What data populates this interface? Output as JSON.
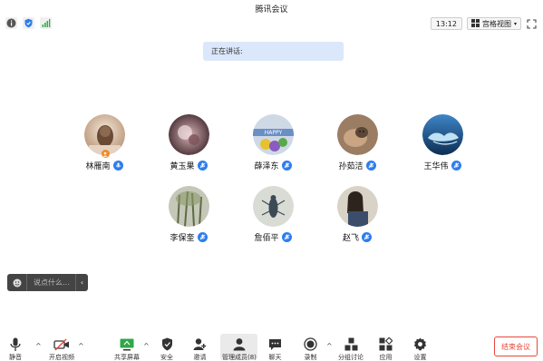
{
  "window": {
    "title": "腾讯会议"
  },
  "top_toolbar": {
    "info_icon": "info-icon",
    "shield_icon": "shield-icon",
    "signal_icon": "signal-icon",
    "time": "13:12",
    "view_label": "宫格视图",
    "fullscreen_icon": "fullscreen-icon"
  },
  "speaking": {
    "label": "正在讲话:"
  },
  "participants": [
    {
      "name": "林雁南",
      "host": true
    },
    {
      "name": "黄玉果"
    },
    {
      "name": "薛泽东"
    },
    {
      "name": "孙茹洁"
    },
    {
      "name": "王华伟"
    },
    {
      "name": "李保奎"
    },
    {
      "name": "詹佰平"
    },
    {
      "name": "赵飞"
    }
  ],
  "chat": {
    "placeholder": "说点什么..."
  },
  "bottom_bar": {
    "mute": "静音",
    "video": "开启视频",
    "share": "共享屏幕",
    "security": "安全",
    "invite": "邀请",
    "members": "管理成员(8)",
    "chat": "聊天",
    "record": "录制",
    "breakout": "分组讨论",
    "apps": "应用",
    "settings": "设置",
    "end": "结束会议"
  },
  "colors": {
    "accent": "#2d7cf0",
    "end": "#e9473a",
    "speaking_bg": "#dbe7fb"
  }
}
